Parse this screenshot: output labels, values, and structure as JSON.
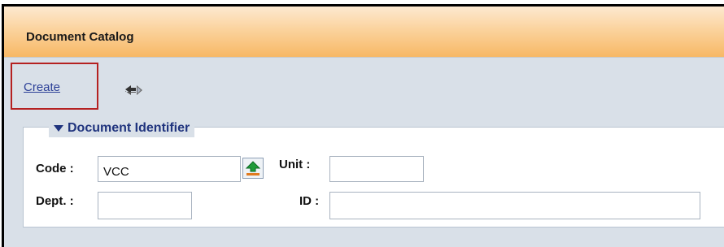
{
  "window": {
    "title": "Document Catalog"
  },
  "toolbar": {
    "create_label": "Create",
    "move_icon": "move-arrows-icon"
  },
  "section": {
    "title": "Document Identifier",
    "toggle_icon": "triangle-down-icon"
  },
  "form": {
    "code": {
      "label": "Code :",
      "value": "VCC"
    },
    "lookup_icon": "upload-arrow-icon",
    "unit": {
      "label": "Unit :",
      "value": ""
    },
    "dept": {
      "label": "Dept. :",
      "value": ""
    },
    "id": {
      "label": "ID :",
      "value": ""
    }
  }
}
